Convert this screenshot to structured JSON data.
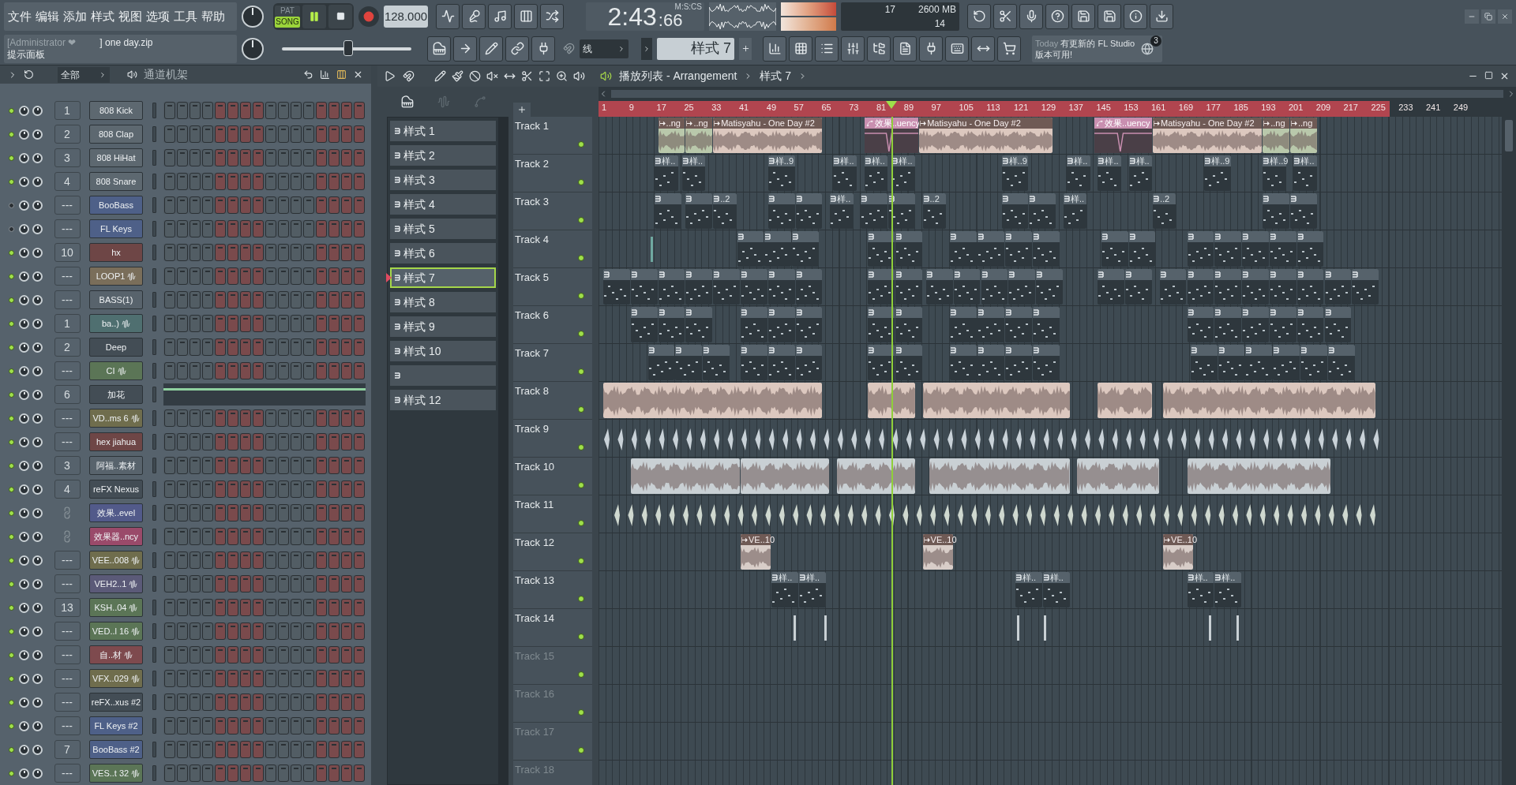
{
  "menu": [
    "文件",
    "编辑",
    "添加",
    "样式",
    "视图",
    "选项",
    "工具",
    "帮助"
  ],
  "transport": {
    "modes": [
      {
        "label": "PAT",
        "selected": false
      },
      {
        "label": "SONG",
        "selected": true
      }
    ],
    "playing": true,
    "tempo": "128.000"
  },
  "time": {
    "main": "2:43",
    "sub": ":66",
    "unit": "M:S:CS"
  },
  "cpu": {
    "polyphony": "17",
    "memory": "2600 MB",
    "voices": "14"
  },
  "hint": {
    "user": "[Administrator ❤",
    "file": "] one day.zip",
    "title": "提示面板"
  },
  "master_volume": {
    "level": 0.51
  },
  "snap": "线",
  "pattern_selector": "样式 7",
  "news": {
    "lead": "Today",
    "text": "有更新的 FL Studio 版本可用!",
    "badge": "3"
  },
  "channel_rack": {
    "filter": "全部",
    "title": "通道机架",
    "channels": [
      {
        "number": "1",
        "name": "808 Kick",
        "kind": "instrument",
        "piano_roll": false,
        "enabled": true,
        "color": "#5d6870"
      },
      {
        "number": "2",
        "name": "808 Clap",
        "kind": "instrument",
        "piano_roll": false,
        "enabled": true,
        "color": "#5d6870"
      },
      {
        "number": "3",
        "name": "808 HiHat",
        "kind": "instrument",
        "piano_roll": false,
        "enabled": true,
        "color": "#5d6870"
      },
      {
        "number": "4",
        "name": "808 Snare",
        "kind": "instrument",
        "piano_roll": false,
        "enabled": true,
        "color": "#5d6870"
      },
      {
        "number": "---",
        "name": "BooBass",
        "kind": "instrument",
        "piano_roll": false,
        "enabled": false,
        "color": "#4e6088"
      },
      {
        "number": "---",
        "name": "FL Keys",
        "kind": "instrument",
        "piano_roll": false,
        "enabled": false,
        "color": "#4e6088"
      },
      {
        "number": "10",
        "name": "hx",
        "kind": "instrument",
        "piano_roll": false,
        "enabled": true,
        "color": "#6e4646"
      },
      {
        "number": "---",
        "name": "LOOP1",
        "kind": "audio",
        "piano_roll": false,
        "enabled": true,
        "color": "#7a6e5a"
      },
      {
        "number": "---",
        "name": "BASS(1)",
        "kind": "instrument",
        "piano_roll": false,
        "enabled": true,
        "color": "#58636c"
      },
      {
        "number": "1",
        "name": "ba..)",
        "kind": "audio",
        "piano_roll": false,
        "enabled": true,
        "color": "#4f6f70"
      },
      {
        "number": "2",
        "name": "Deep",
        "kind": "instrument",
        "piano_roll": false,
        "enabled": true,
        "color": "#434d55"
      },
      {
        "number": "---",
        "name": "CI",
        "kind": "audio",
        "piano_roll": false,
        "enabled": true,
        "color": "#5b7556"
      },
      {
        "number": "6",
        "name": "加花",
        "kind": "instrument",
        "piano_roll": true,
        "enabled": true,
        "color": "#434d55"
      },
      {
        "number": "---",
        "name": "VD..ms 6",
        "kind": "audio",
        "piano_roll": false,
        "enabled": true,
        "color": "#6f6d4d"
      },
      {
        "number": "---",
        "name": "hex jiahua",
        "kind": "instrument",
        "piano_roll": false,
        "enabled": true,
        "color": "#6e4646"
      },
      {
        "number": "3",
        "name": "阿福..素材",
        "kind": "instrument",
        "piano_roll": false,
        "enabled": true,
        "color": "#58636c"
      },
      {
        "number": "4",
        "name": "reFX Nexus",
        "kind": "instrument",
        "piano_roll": false,
        "enabled": true,
        "color": "#434d55"
      },
      {
        "name": "效果..evel",
        "kind": "automation",
        "piano_roll": false,
        "enabled": true,
        "color": "#525a8a"
      },
      {
        "name": "效果器..ncy",
        "kind": "automation",
        "piano_roll": false,
        "enabled": true,
        "color": "#9a4a6a"
      },
      {
        "number": "---",
        "name": "VEE..008",
        "kind": "audio",
        "piano_roll": false,
        "enabled": true,
        "color": "#6f6d4d"
      },
      {
        "number": "---",
        "name": "VEH2..1",
        "kind": "audio",
        "piano_roll": false,
        "enabled": true,
        "color": "#5b5a78"
      },
      {
        "number": "13",
        "name": "KSH..04",
        "kind": "audio",
        "piano_roll": false,
        "enabled": true,
        "color": "#5b7556"
      },
      {
        "number": "---",
        "name": "VED..l 16",
        "kind": "audio",
        "piano_roll": false,
        "enabled": true,
        "color": "#5b7556"
      },
      {
        "number": "---",
        "name": "自..材",
        "kind": "audio",
        "piano_roll": false,
        "enabled": true,
        "color": "#7e4a4e"
      },
      {
        "number": "---",
        "name": "VFX..029",
        "kind": "audio",
        "piano_roll": false,
        "enabled": true,
        "color": "#6f6d4d"
      },
      {
        "number": "---",
        "name": "reFX..xus #2",
        "kind": "instrument",
        "piano_roll": false,
        "enabled": true,
        "color": "#434d55"
      },
      {
        "number": "---",
        "name": "FL Keys #2",
        "kind": "instrument",
        "piano_roll": false,
        "enabled": true,
        "color": "#4e6088"
      },
      {
        "number": "7",
        "name": "BooBass #2",
        "kind": "instrument",
        "piano_roll": false,
        "enabled": true,
        "color": "#4e6088"
      },
      {
        "number": "---",
        "name": "VES..t 32",
        "kind": "audio",
        "piano_roll": false,
        "enabled": true,
        "color": "#5b7556"
      }
    ]
  },
  "playlist": {
    "title": "播放列表 - Arrangement",
    "pattern": "样式 7",
    "patterns": [
      {
        "label": "样式 1",
        "selected": false
      },
      {
        "label": "样式 2",
        "selected": false
      },
      {
        "label": "样式 3",
        "selected": false
      },
      {
        "label": "样式 4",
        "selected": false
      },
      {
        "label": "样式 5",
        "selected": false
      },
      {
        "label": "样式 6",
        "selected": false
      },
      {
        "label": "样式 7",
        "selected": true
      },
      {
        "label": "样式 8",
        "selected": false
      },
      {
        "label": "样式 9",
        "selected": false
      },
      {
        "label": "样式 10",
        "selected": false
      },
      {
        "selected": false
      },
      {
        "label": "样式 12",
        "selected": false
      }
    ],
    "bar_numbers": [
      "1",
      "9",
      "17",
      "25",
      "33",
      "41",
      "49",
      "57",
      "65",
      "73",
      "81",
      "89",
      "97",
      "105",
      "113",
      "121",
      "129",
      "137",
      "145",
      "153",
      "161",
      "169",
      "177",
      "185",
      "193",
      "201",
      "209",
      "217",
      "225",
      "233",
      "241",
      "249"
    ],
    "tracks": [
      {
        "name": "Track 1",
        "empty": false,
        "clips": [
          {
            "kind": "audio",
            "label": "..ng",
            "color": "#b9c8ab"
          },
          {
            "kind": "audio",
            "label": "..ng",
            "color": "#b9c8ab"
          },
          {
            "kind": "audio",
            "label": "Matisyahu - One Day #2",
            "color": "#dcc8bf"
          },
          {
            "kind": "automation",
            "label": "效果..uency",
            "color": "#c98fb0"
          },
          {
            "kind": "audio",
            "label": "Matisyahu - One Day #2",
            "color": "#dcc8bf"
          },
          {
            "kind": "automation",
            "label": "效果..uency",
            "color": "#c98fb0"
          },
          {
            "kind": "audio",
            "label": "Matisyahu - One Day #2",
            "color": "#dcc8bf"
          },
          {
            "kind": "audio",
            "label": "..ng",
            "color": "#b9c8ab"
          },
          {
            "kind": "audio",
            "label": "..ng",
            "color": "#b9c8ab"
          }
        ]
      },
      {
        "name": "Track 2",
        "empty": false,
        "clips": [
          {
            "kind": "pattern",
            "label": "样.."
          },
          {
            "kind": "pattern",
            "label": "样.."
          },
          {
            "kind": "pattern",
            "label": "样..9"
          },
          {
            "kind": "pattern",
            "label": "样.."
          },
          {
            "kind": "pattern",
            "label": "样.."
          },
          {
            "kind": "pattern",
            "label": "样.."
          },
          {
            "kind": "pattern",
            "label": "样..9"
          },
          {
            "kind": "pattern",
            "label": "样.."
          },
          {
            "kind": "pattern",
            "label": "样.."
          },
          {
            "kind": "pattern",
            "label": "样.."
          },
          {
            "kind": "pattern",
            "label": "样..9"
          },
          {
            "kind": "pattern",
            "label": "样..9"
          },
          {
            "kind": "pattern",
            "label": "样.."
          }
        ]
      },
      {
        "name": "Track 3",
        "empty": false,
        "clips": [
          {
            "kind": "pattern"
          },
          {
            "kind": "pattern"
          },
          {
            "kind": "pattern",
            "label": "..2"
          },
          {
            "kind": "pattern"
          },
          {
            "kind": "pattern"
          },
          {
            "kind": "pattern",
            "label": "样.."
          },
          {
            "kind": "pattern"
          },
          {
            "kind": "pattern"
          },
          {
            "kind": "pattern",
            "label": "..2"
          },
          {
            "kind": "pattern"
          },
          {
            "kind": "pattern"
          },
          {
            "kind": "pattern",
            "label": "样.."
          },
          {
            "kind": "pattern",
            "label": "..2"
          },
          {
            "kind": "pattern"
          },
          {
            "kind": "pattern"
          }
        ]
      },
      {
        "name": "Track 4",
        "empty": false,
        "clips": [
          {
            "kind": "automation",
            "color": "#6fa8a0"
          },
          {
            "kind": "pattern"
          },
          {
            "kind": "pattern"
          },
          {
            "kind": "pattern"
          },
          {
            "kind": "pattern"
          },
          {
            "kind": "pattern"
          },
          {
            "kind": "pattern"
          },
          {
            "kind": "pattern"
          },
          {
            "kind": "pattern"
          },
          {
            "kind": "pattern"
          },
          {
            "kind": "pattern"
          },
          {
            "kind": "pattern"
          },
          {
            "kind": "pattern"
          },
          {
            "kind": "pattern"
          },
          {
            "kind": "pattern"
          },
          {
            "kind": "pattern"
          },
          {
            "kind": "pattern"
          }
        ]
      },
      {
        "name": "Track 5",
        "empty": false,
        "clips": [
          {
            "kind": "pattern"
          },
          {
            "kind": "pattern"
          },
          {
            "kind": "pattern"
          },
          {
            "kind": "pattern"
          },
          {
            "kind": "pattern"
          },
          {
            "kind": "pattern"
          },
          {
            "kind": "pattern"
          },
          {
            "kind": "pattern"
          },
          {
            "kind": "pattern"
          },
          {
            "kind": "pattern"
          },
          {
            "kind": "pattern"
          },
          {
            "kind": "pattern"
          },
          {
            "kind": "pattern"
          },
          {
            "kind": "pattern"
          },
          {
            "kind": "pattern"
          },
          {
            "kind": "pattern"
          },
          {
            "kind": "pattern"
          },
          {
            "kind": "pattern"
          },
          {
            "kind": "pattern"
          },
          {
            "kind": "pattern"
          },
          {
            "kind": "pattern"
          },
          {
            "kind": "pattern"
          },
          {
            "kind": "pattern"
          },
          {
            "kind": "pattern"
          },
          {
            "kind": "pattern"
          }
        ]
      },
      {
        "name": "Track 6",
        "empty": false,
        "clips": [
          {
            "kind": "pattern"
          },
          {
            "kind": "pattern"
          },
          {
            "kind": "pattern"
          },
          {
            "kind": "pattern"
          },
          {
            "kind": "pattern"
          },
          {
            "kind": "pattern"
          },
          {
            "kind": "pattern"
          },
          {
            "kind": "pattern"
          },
          {
            "kind": "pattern"
          },
          {
            "kind": "pattern"
          },
          {
            "kind": "pattern"
          },
          {
            "kind": "pattern"
          },
          {
            "kind": "pattern"
          },
          {
            "kind": "pattern"
          },
          {
            "kind": "pattern"
          },
          {
            "kind": "pattern"
          },
          {
            "kind": "pattern"
          },
          {
            "kind": "pattern"
          }
        ]
      },
      {
        "name": "Track 7",
        "empty": false,
        "clips": [
          {
            "kind": "pattern"
          },
          {
            "kind": "pattern"
          },
          {
            "kind": "pattern"
          },
          {
            "kind": "pattern"
          },
          {
            "kind": "pattern"
          },
          {
            "kind": "pattern"
          },
          {
            "kind": "pattern"
          },
          {
            "kind": "pattern"
          },
          {
            "kind": "pattern"
          },
          {
            "kind": "pattern"
          },
          {
            "kind": "pattern"
          },
          {
            "kind": "pattern"
          },
          {
            "kind": "pattern"
          },
          {
            "kind": "pattern"
          },
          {
            "kind": "pattern"
          },
          {
            "kind": "pattern"
          },
          {
            "kind": "pattern"
          },
          {
            "kind": "pattern"
          }
        ]
      },
      {
        "name": "Track 8",
        "empty": false,
        "clips": [
          {
            "kind": "audio",
            "color": "#dcc8bf"
          },
          {
            "kind": "audio",
            "color": "#dcc8bf"
          },
          {
            "kind": "audio",
            "color": "#dcc8bf"
          },
          {
            "kind": "audio",
            "color": "#dcc8bf"
          },
          {
            "kind": "audio",
            "color": "#dcc8bf"
          }
        ]
      },
      {
        "name": "Track 9",
        "empty": false,
        "clips": [
          {
            "kind": "hits",
            "color": "#c9d2d8"
          }
        ]
      },
      {
        "name": "Track 10",
        "empty": false,
        "clips": [
          {
            "kind": "audio",
            "color": "#c9d0d4"
          },
          {
            "kind": "audio",
            "color": "#c9d0d4"
          },
          {
            "kind": "audio",
            "color": "#c9d0d4"
          },
          {
            "kind": "audio",
            "color": "#c9d0d4"
          },
          {
            "kind": "audio",
            "color": "#c9d0d4"
          },
          {
            "kind": "audio",
            "color": "#c9d0d4"
          }
        ]
      },
      {
        "name": "Track 11",
        "empty": false,
        "clips": [
          {
            "kind": "hits",
            "color": "#cfd8cf"
          }
        ]
      },
      {
        "name": "Track 12",
        "empty": false,
        "clips": [
          {
            "kind": "audio",
            "label": "VE..10",
            "color": "#d8cdc8"
          },
          {
            "kind": "audio",
            "label": "VE..10",
            "color": "#d8cdc8"
          },
          {
            "kind": "audio",
            "label": "VE..10",
            "color": "#d8cdc8"
          }
        ]
      },
      {
        "name": "Track 13",
        "empty": false,
        "clips": [
          {
            "kind": "pattern",
            "label": "样.."
          },
          {
            "kind": "pattern",
            "label": "样.."
          },
          {
            "kind": "pattern",
            "label": "样.."
          },
          {
            "kind": "pattern",
            "label": "样.."
          },
          {
            "kind": "pattern",
            "label": "样.."
          },
          {
            "kind": "pattern",
            "label": "样.."
          }
        ]
      },
      {
        "name": "Track 14",
        "empty": false,
        "clips": [
          {
            "kind": "automation",
            "color": "#c9d0d4"
          },
          {
            "kind": "automation",
            "color": "#c9d0d4"
          },
          {
            "kind": "automation",
            "color": "#c9d0d4"
          },
          {
            "kind": "automation",
            "color": "#c9d0d4"
          },
          {
            "kind": "automation",
            "color": "#c9d0d4"
          },
          {
            "kind": "automation",
            "color": "#c9d0d4"
          }
        ]
      },
      {
        "name": "Track 15",
        "empty": true
      },
      {
        "name": "Track 16",
        "empty": true
      },
      {
        "name": "Track 17",
        "empty": true
      },
      {
        "name": "Track 18",
        "empty": true
      }
    ]
  }
}
